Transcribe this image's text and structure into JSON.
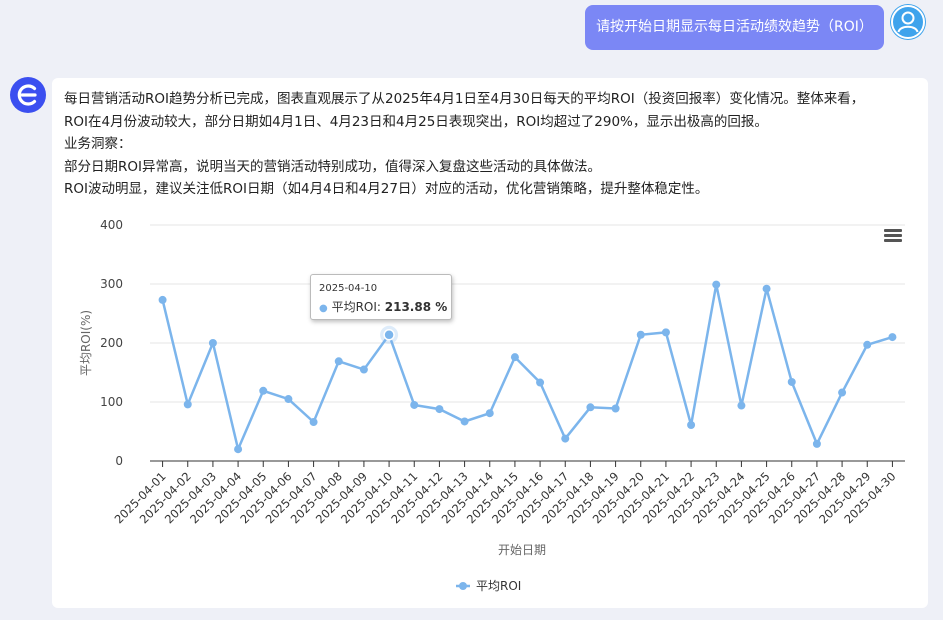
{
  "user_message": "请按开始日期显示每日活动绩效趋势（ROI）",
  "bot_message": {
    "lines": [
      "每日营销活动ROI趋势分析已完成，图表直观展示了从2025年4月1日至4月30日每天的平均ROI（投资回报率）变化情况。整体来看，",
      "ROI在4月份波动较大，部分日期如4月1日、4月23日和4月25日表现突出，ROI均超过了290%，显示出极高的回报。",
      "业务洞察：",
      "部分日期ROI异常高，说明当天的营销活动特别成功，值得深入复盘这些活动的具体做法。",
      "ROI波动明显，建议关注低ROI日期（如4月4日和4月27日）对应的活动，优化营销策略，提升整体稳定性。"
    ]
  },
  "colors": {
    "series": "#7cb5ec",
    "user_bubble": "#7b87f5",
    "bot_avatar": "#3b4ff0"
  },
  "icons": {
    "user_avatar": "user-avatar-icon",
    "bot_avatar": "e-logo-icon",
    "chart_menu": "hamburger-menu-icon"
  },
  "tooltip": {
    "date": "2025-04-10",
    "series_label": "平均ROI: ",
    "value": "213.88 %"
  },
  "chart_data": {
    "type": "line",
    "xlabel": "开始日期",
    "ylabel": "平均ROI(%)",
    "ylim": [
      0,
      400
    ],
    "yticks": [
      0,
      100,
      200,
      300,
      400
    ],
    "grid": true,
    "legend_position": "bottom-center",
    "categories": [
      "2025-04-01",
      "2025-04-02",
      "2025-04-03",
      "2025-04-04",
      "2025-04-05",
      "2025-04-06",
      "2025-04-07",
      "2025-04-08",
      "2025-04-09",
      "2025-04-10",
      "2025-04-11",
      "2025-04-12",
      "2025-04-13",
      "2025-04-14",
      "2025-04-15",
      "2025-04-16",
      "2025-04-17",
      "2025-04-18",
      "2025-04-19",
      "2025-04-20",
      "2025-04-21",
      "2025-04-22",
      "2025-04-23",
      "2025-04-24",
      "2025-04-25",
      "2025-04-26",
      "2025-04-27",
      "2025-04-28",
      "2025-04-29",
      "2025-04-30"
    ],
    "series": [
      {
        "name": "平均ROI",
        "values": [
          273,
          96,
          200,
          20,
          119,
          105,
          66,
          169,
          155,
          213.88,
          95,
          88,
          67,
          81,
          176,
          133,
          38,
          91,
          89,
          214,
          218,
          61,
          299,
          94,
          292,
          134,
          29,
          116,
          197,
          210
        ]
      }
    ],
    "highlighted_index": 9
  }
}
